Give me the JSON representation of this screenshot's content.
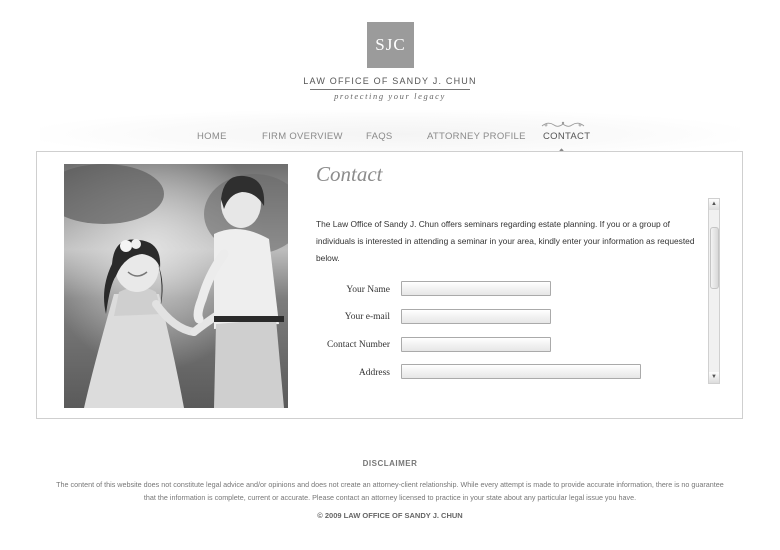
{
  "header": {
    "logo_text": "SJC",
    "firm_name": "LAW OFFICE OF SANDY J. CHUN",
    "tagline": "protecting your legacy"
  },
  "nav": {
    "items": [
      {
        "label": "HOME"
      },
      {
        "label": "FIRM OVERVIEW"
      },
      {
        "label": "FAQS"
      },
      {
        "label": "ATTORNEY PROFILE"
      },
      {
        "label": "CONTACT",
        "active": true
      }
    ]
  },
  "main": {
    "title": "Contact",
    "intro": "The Law Office of Sandy J. Chun offers seminars regarding estate planning. If you or a group of individuals is interested in attending a seminar in your area, kindly enter your information as requested below.",
    "form": {
      "name_label": "Your Name",
      "name_value": "",
      "email_label": "Your e-mail",
      "email_value": "",
      "phone_label": "Contact Number",
      "phone_value": "",
      "address_label": "Address",
      "address_value": ""
    },
    "scroll_up": "▲",
    "scroll_down": "▼"
  },
  "footer": {
    "disclaimer_title": "DISCLAIMER",
    "disclaimer_text": "The content of this website does not constitute legal advice and/or opinions and does not create an attorney-client relationship. While every attempt is made to provide accurate information, there is no guarantee that the information is complete, current or accurate. Please contact an attorney licensed to practice in your state about any particular legal issue you have.",
    "copyright": "© 2009 LAW OFFICE OF SANDY J. CHUN"
  },
  "colors": {
    "logo_bg": "#9b9b9b",
    "title_gray": "#8c8c8c",
    "nav_gray": "#8a8a8a"
  }
}
